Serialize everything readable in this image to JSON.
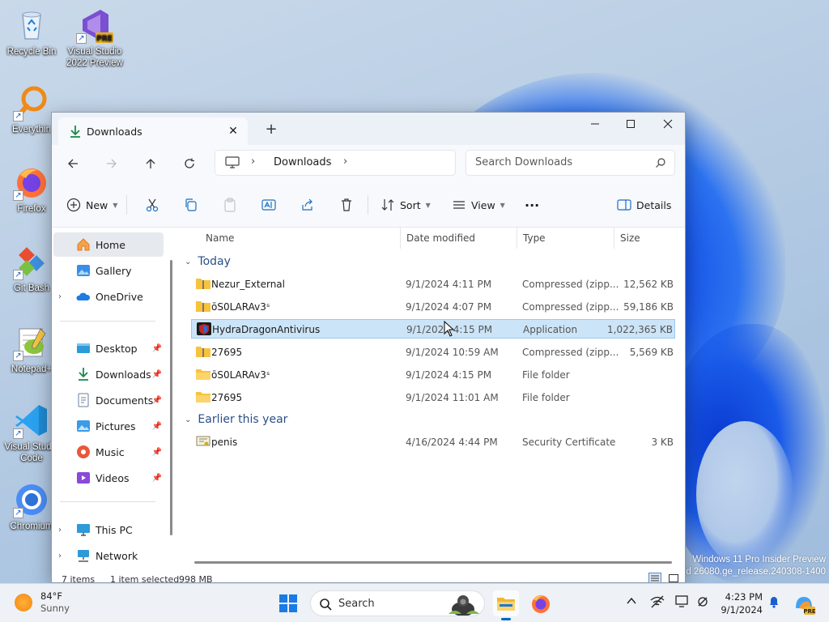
{
  "desktop": {
    "icons": [
      {
        "label": "Recycle Bin",
        "icon": "recycle-bin-icon"
      },
      {
        "label": "Visual Studio 2022 Preview",
        "icon": "visual-studio-icon",
        "badge": "PRE"
      },
      {
        "label": "Everythin",
        "icon": "everything-search-icon"
      },
      {
        "label": "Firefox",
        "icon": "firefox-icon"
      },
      {
        "label": "Git Bash",
        "icon": "git-bash-icon"
      },
      {
        "label": "Notepad+",
        "icon": "notepad-plus-icon"
      },
      {
        "label": "Visual Studio Code",
        "icon": "vscode-icon"
      },
      {
        "label": "Chromium",
        "icon": "chromium-icon"
      }
    ],
    "watermark_line1": "Windows 11 Pro Insider Preview",
    "watermark_line2": "ild 26080.ge_release.240308-1400"
  },
  "window": {
    "tab_title": "Downloads",
    "new_tab": "+",
    "minimize": "—",
    "close": "✕",
    "address": {
      "crumb": "Downloads",
      "separator": "›"
    },
    "search_placeholder": "Search Downloads",
    "commands": {
      "new": "New",
      "sort": "Sort",
      "view": "View",
      "more": "···",
      "details": "Details"
    },
    "nav": {
      "home": "Home",
      "gallery": "Gallery",
      "onedrive": "OneDrive",
      "desktop": "Desktop",
      "downloads": "Downloads",
      "documents": "Documents",
      "pictures": "Pictures",
      "music": "Music",
      "videos": "Videos",
      "this_pc": "This PC",
      "network": "Network"
    },
    "columns": {
      "name": "Name",
      "date": "Date modified",
      "type": "Type",
      "size": "Size"
    },
    "groups": {
      "today": "Today",
      "earlier": "Earlier this year"
    },
    "files": [
      {
        "name": "Nezur_External",
        "date": "9/1/2024 4:11 PM",
        "type": "Compressed (zipp...",
        "size": "12,562 KB",
        "icon": "zip-folder-icon"
      },
      {
        "name": "ōS0LARAv3ˢ",
        "date": "9/1/2024 4:07 PM",
        "type": "Compressed (zipp...",
        "size": "59,186 KB",
        "icon": "zip-folder-icon"
      },
      {
        "name": "HydraDragonAntivirus",
        "date": "9/1/2024 4:15 PM",
        "type": "Application",
        "size": "1,022,365 KB",
        "icon": "application-icon",
        "selected": true
      },
      {
        "name": "27695",
        "date": "9/1/2024 10:59 AM",
        "type": "Compressed (zipp...",
        "size": "5,569 KB",
        "icon": "zip-folder-icon"
      },
      {
        "name": "ōS0LARAv3ˢ",
        "date": "9/1/2024 4:15 PM",
        "type": "File folder",
        "size": "",
        "icon": "folder-icon"
      },
      {
        "name": "27695",
        "date": "9/1/2024 11:01 AM",
        "type": "File folder",
        "size": "",
        "icon": "folder-icon"
      }
    ],
    "earlier_files": [
      {
        "name": "penis",
        "date": "4/16/2024 4:44 PM",
        "type": "Security Certificate",
        "size": "3 KB",
        "icon": "certificate-icon"
      }
    ],
    "status": {
      "items": "7 items",
      "selected": "1 item selected",
      "size": "998 MB"
    }
  },
  "taskbar": {
    "temperature": "84°F",
    "condition": "Sunny",
    "search_label": "Search",
    "time": "4:23 PM",
    "date": "9/1/2024"
  },
  "colors": {
    "accent": "#0067c0",
    "selection": "#cce4f7",
    "folder": "#f8c33c"
  }
}
